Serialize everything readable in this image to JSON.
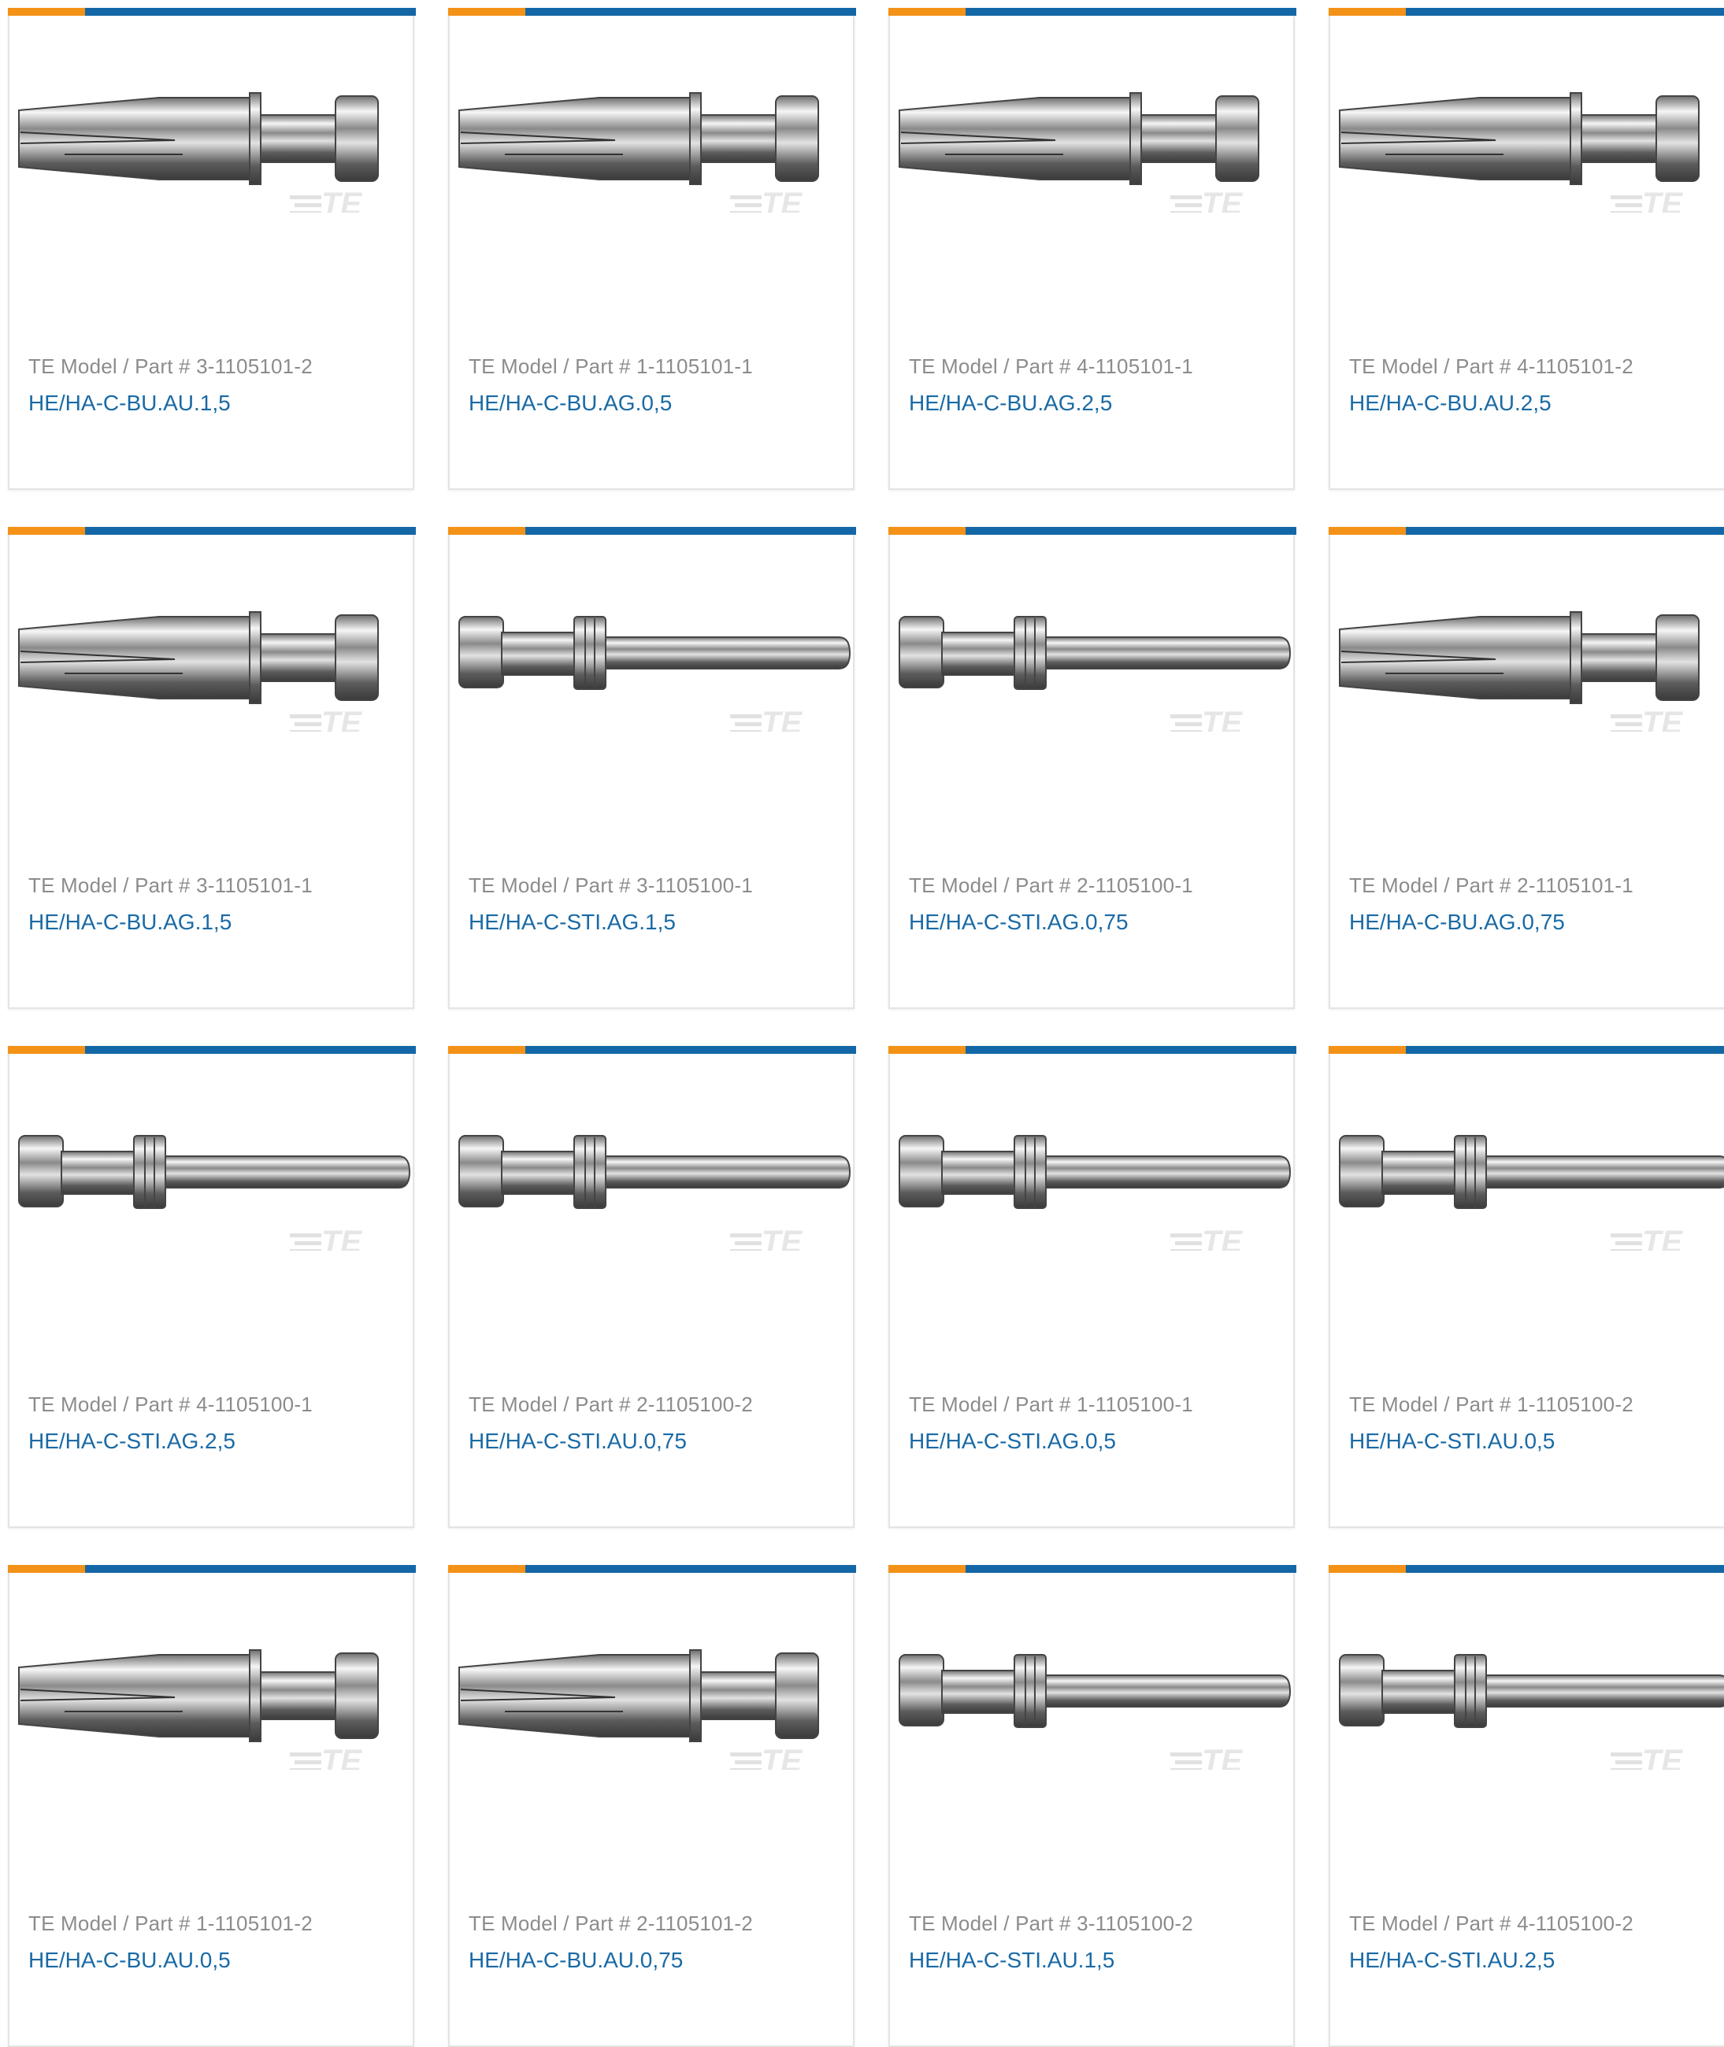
{
  "colors": {
    "accent_orange": "#f39217",
    "accent_blue": "#1467a6",
    "link": "#1a6aa5",
    "label": "#8c8c8c"
  },
  "watermark": "TE",
  "cards": [
    {
      "kind": "socket",
      "part_label": "TE Model / Part # 3-1105101-2",
      "model": "HE/HA-C-BU.AU.1,5"
    },
    {
      "kind": "socket",
      "part_label": "TE Model / Part # 1-1105101-1",
      "model": "HE/HA-C-BU.AG.0,5"
    },
    {
      "kind": "socket",
      "part_label": "TE Model / Part # 4-1105101-1",
      "model": "HE/HA-C-BU.AG.2,5"
    },
    {
      "kind": "socket",
      "part_label": "TE Model / Part # 4-1105101-2",
      "model": "HE/HA-C-BU.AU.2,5"
    },
    {
      "kind": "socket",
      "part_label": "TE Model / Part # 3-1105101-1",
      "model": "HE/HA-C-BU.AG.1,5"
    },
    {
      "kind": "pin",
      "part_label": "TE Model / Part # 3-1105100-1",
      "model": "HE/HA-C-STI.AG.1,5"
    },
    {
      "kind": "pin",
      "part_label": "TE Model / Part # 2-1105100-1",
      "model": "HE/HA-C-STI.AG.0,75"
    },
    {
      "kind": "socket",
      "part_label": "TE Model / Part # 2-1105101-1",
      "model": "HE/HA-C-BU.AG.0,75"
    },
    {
      "kind": "pin",
      "part_label": "TE Model / Part # 4-1105100-1",
      "model": "HE/HA-C-STI.AG.2,5"
    },
    {
      "kind": "pin",
      "part_label": "TE Model / Part # 2-1105100-2",
      "model": "HE/HA-C-STI.AU.0,75"
    },
    {
      "kind": "pin",
      "part_label": "TE Model / Part # 1-1105100-1",
      "model": "HE/HA-C-STI.AG.0,5"
    },
    {
      "kind": "pin",
      "part_label": "TE Model / Part # 1-1105100-2",
      "model": "HE/HA-C-STI.AU.0,5"
    },
    {
      "kind": "socket",
      "part_label": "TE Model / Part # 1-1105101-2",
      "model": "HE/HA-C-BU.AU.0,5"
    },
    {
      "kind": "socket",
      "part_label": "TE Model / Part # 2-1105101-2",
      "model": "HE/HA-C-BU.AU.0,75"
    },
    {
      "kind": "pin",
      "part_label": "TE Model / Part # 3-1105100-2",
      "model": "HE/HA-C-STI.AU.1,5"
    },
    {
      "kind": "pin",
      "part_label": "TE Model / Part # 4-1105100-2",
      "model": "HE/HA-C-STI.AU.2,5"
    }
  ]
}
